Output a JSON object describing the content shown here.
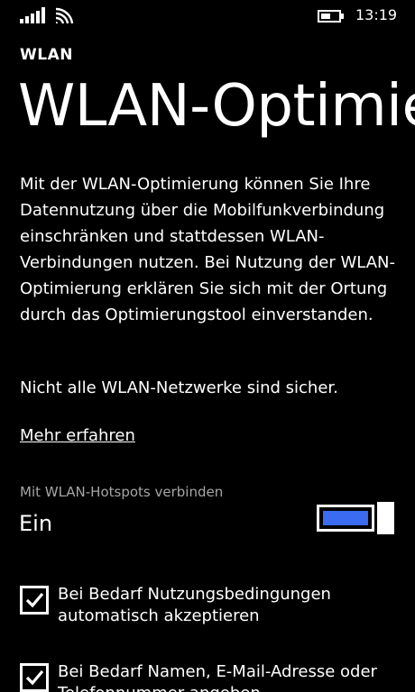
{
  "status_bar": {
    "time": "13:19",
    "signal_icon": "signal-strength-icon",
    "wifi_icon": "wifi-icon",
    "battery_icon": "battery-icon"
  },
  "app_title": "WLAN",
  "page_title": "WLAN-Optimierung",
  "description": "Mit der WLAN-Optimierung können Sie Ihre Datennutzung über die Mobilfunkverbindung einschränken und stattdessen WLAN-Verbindungen nutzen. Bei Nutzung der WLAN-Optimierung erklären Sie sich mit der Ortung durch das Optimierungstool einverstanden.",
  "warning": "Nicht alle WLAN-Netzwerke sind sicher.",
  "learn_more_link": "Mehr erfahren",
  "hotspot_toggle": {
    "label": "Mit WLAN-Hotspots verbinden",
    "state_text": "Ein",
    "on": true
  },
  "checkboxes": [
    {
      "label": "Bei Bedarf Nutzungsbedingungen automatisch akzeptieren",
      "checked": true
    },
    {
      "label": "Bei Bedarf Namen, E-Mail-Adresse oder Telefonnummer angeben",
      "checked": true
    }
  ],
  "colors": {
    "background": "#000000",
    "foreground": "#ffffff",
    "accent": "#3a6bf0",
    "subtle_text": "#a6a6a6"
  }
}
